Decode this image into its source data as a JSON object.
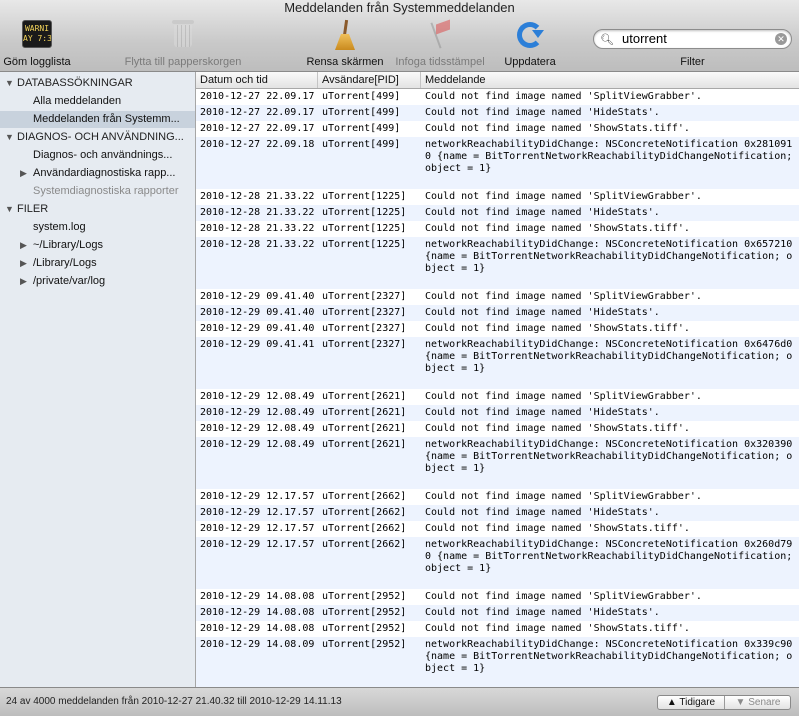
{
  "window": {
    "title": "Meddelanden från Systemmeddelanden"
  },
  "toolbar": {
    "hide_log_list": "Göm logglista",
    "console_icon_text": "WARNI\nAY 7:36",
    "move_to_trash": "Flytta till papperskorgen",
    "clear_screen": "Rensa skärmen",
    "insert_timestamp": "Infoga tidsstämpel",
    "update": "Uppdatera",
    "search_value": "utorrent",
    "filter_label": "Filter"
  },
  "sidebar": {
    "items": [
      {
        "label": "DATABASSÖKNINGAR",
        "type": "header",
        "expanded": true
      },
      {
        "label": "Alla meddelanden",
        "type": "item"
      },
      {
        "label": "Meddelanden från Systemm...",
        "type": "item",
        "selected": true
      },
      {
        "label": "DIAGNOS- OCH ANVÄNDNING...",
        "type": "header",
        "expanded": true
      },
      {
        "label": "Diagnos- och användnings...",
        "type": "item"
      },
      {
        "label": "Användardiagnostiska rapp...",
        "type": "item",
        "collapsible": true
      },
      {
        "label": "Systemdiagnostiska rapporter",
        "type": "item",
        "dim": true
      },
      {
        "label": "FILER",
        "type": "header",
        "expanded": true
      },
      {
        "label": "system.log",
        "type": "item"
      },
      {
        "label": "~/Library/Logs",
        "type": "item",
        "collapsible": true
      },
      {
        "label": "/Library/Logs",
        "type": "item",
        "collapsible": true
      },
      {
        "label": "/private/var/log",
        "type": "item",
        "collapsible": true
      }
    ]
  },
  "table": {
    "columns": [
      "Datum och tid",
      "Avsändare[PID]",
      "Meddelande"
    ],
    "rows": [
      [
        "2010-12-27 22.09.17",
        "uTorrent[499]",
        "Could not find image named 'SplitViewGrabber'."
      ],
      [
        "2010-12-27 22.09.17",
        "uTorrent[499]",
        "Could not find image named 'HideStats'."
      ],
      [
        "2010-12-27 22.09.17",
        "uTorrent[499]",
        "Could not find image named 'ShowStats.tiff'."
      ],
      [
        "2010-12-27 22.09.18",
        "uTorrent[499]",
        "networkReachabilityDidChange: NSConcreteNotification 0x2810910 {name = BitTorrentNetworkReachabilityDidChangeNotification; object = 1}"
      ],
      [
        "2010-12-28 21.33.22",
        "uTorrent[1225]",
        "Could not find image named 'SplitViewGrabber'."
      ],
      [
        "2010-12-28 21.33.22",
        "uTorrent[1225]",
        "Could not find image named 'HideStats'."
      ],
      [
        "2010-12-28 21.33.22",
        "uTorrent[1225]",
        "Could not find image named 'ShowStats.tiff'."
      ],
      [
        "2010-12-28 21.33.22",
        "uTorrent[1225]",
        "networkReachabilityDidChange: NSConcreteNotification 0x657210 {name = BitTorrentNetworkReachabilityDidChangeNotification; object = 1}"
      ],
      [
        "2010-12-29 09.41.40",
        "uTorrent[2327]",
        "Could not find image named 'SplitViewGrabber'."
      ],
      [
        "2010-12-29 09.41.40",
        "uTorrent[2327]",
        "Could not find image named 'HideStats'."
      ],
      [
        "2010-12-29 09.41.40",
        "uTorrent[2327]",
        "Could not find image named 'ShowStats.tiff'."
      ],
      [
        "2010-12-29 09.41.41",
        "uTorrent[2327]",
        "networkReachabilityDidChange: NSConcreteNotification 0x6476d0 {name = BitTorrentNetworkReachabilityDidChangeNotification; object = 1}"
      ],
      [
        "2010-12-29 12.08.49",
        "uTorrent[2621]",
        "Could not find image named 'SplitViewGrabber'."
      ],
      [
        "2010-12-29 12.08.49",
        "uTorrent[2621]",
        "Could not find image named 'HideStats'."
      ],
      [
        "2010-12-29 12.08.49",
        "uTorrent[2621]",
        "Could not find image named 'ShowStats.tiff'."
      ],
      [
        "2010-12-29 12.08.49",
        "uTorrent[2621]",
        "networkReachabilityDidChange: NSConcreteNotification 0x320390 {name = BitTorrentNetworkReachabilityDidChangeNotification; object = 1}"
      ],
      [
        "2010-12-29 12.17.57",
        "uTorrent[2662]",
        "Could not find image named 'SplitViewGrabber'."
      ],
      [
        "2010-12-29 12.17.57",
        "uTorrent[2662]",
        "Could not find image named 'HideStats'."
      ],
      [
        "2010-12-29 12.17.57",
        "uTorrent[2662]",
        "Could not find image named 'ShowStats.tiff'."
      ],
      [
        "2010-12-29 12.17.57",
        "uTorrent[2662]",
        "networkReachabilityDidChange: NSConcreteNotification 0x260d790 {name = BitTorrentNetworkReachabilityDidChangeNotification; object = 1}"
      ],
      [
        "2010-12-29 14.08.08",
        "uTorrent[2952]",
        "Could not find image named 'SplitViewGrabber'."
      ],
      [
        "2010-12-29 14.08.08",
        "uTorrent[2952]",
        "Could not find image named 'HideStats'."
      ],
      [
        "2010-12-29 14.08.08",
        "uTorrent[2952]",
        "Could not find image named 'ShowStats.tiff'."
      ],
      [
        "2010-12-29 14.08.09",
        "uTorrent[2952]",
        "networkReachabilityDidChange: NSConcreteNotification 0x339c90 {name = BitTorrentNetworkReachabilityDidChangeNotification; object = 1}"
      ]
    ]
  },
  "status": {
    "text": "24 av 4000 meddelanden från 2010-12-27 21.40.32 till 2010-12-29 14.11.13",
    "earlier": "Tidigare",
    "later": "Senare"
  }
}
